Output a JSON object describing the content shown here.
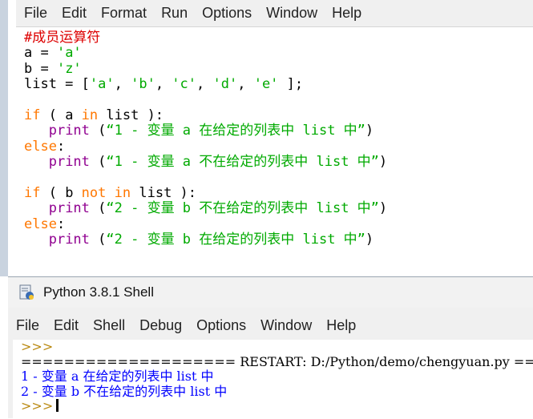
{
  "editor": {
    "menu": [
      "File",
      "Edit",
      "Format",
      "Run",
      "Options",
      "Window",
      "Help"
    ],
    "code": {
      "l1": "#成员运算符",
      "l2a": "a = ",
      "l2s": "'a'",
      "l3a": "b = ",
      "l3s": "'z'",
      "l4a": "list = [",
      "l4s1": "'a'",
      "l4c1": ", ",
      "l4s2": "'b'",
      "l4c2": ", ",
      "l4s3": "'c'",
      "l4c3": ", ",
      "l4s4": "'d'",
      "l4c4": ", ",
      "l4s5": "'e'",
      "l4e": " ];",
      "if1_kw": "if",
      "if1_a": " ( a ",
      "if1_in": "in",
      "if1_b": " list ):",
      "p1_pre": "   ",
      "p1_fn": "print",
      "p1_a": " (",
      "p1_s": "“1 - 变量 a 在给定的列表中 list 中”",
      "p1_e": ")",
      "else1": "else",
      "else1_c": ":",
      "p2_fn": "print",
      "p2_a": " (",
      "p2_s": "“1 - 变量 a 不在给定的列表中 list 中”",
      "p2_e": ")",
      "if2_kw": "if",
      "if2_a": " ( b ",
      "if2_not": "not",
      "if2_sp": " ",
      "if2_in": "in",
      "if2_b": " list ):",
      "p3_fn": "print",
      "p3_a": " (",
      "p3_s": "“2 - 变量 b 不在给定的列表中 list 中”",
      "p3_e": ")",
      "else2": "else",
      "else2_c": ":",
      "p4_fn": "print",
      "p4_a": " (",
      "p4_s": "“2 - 变量 b 在给定的列表中 list 中”",
      "p4_e": ")"
    }
  },
  "shell": {
    "title": "Python 3.8.1 Shell",
    "menu": [
      "File",
      "Edit",
      "Shell",
      "Debug",
      "Options",
      "Window",
      "Help"
    ],
    "lines": {
      "p1": ">>>",
      "restart": "==================== RESTART: D:/Python/demo/chengyuan.py ====================",
      "out1": "1 - 变量 a 在给定的列表中 list 中",
      "out2": "2 - 变量 b 不在给定的列表中 list 中",
      "p2": ">>>"
    }
  },
  "colors": {
    "comment": "#dd0000",
    "string": "#00aa00",
    "keyword": "#ff7700",
    "builtin": "#900090",
    "output": "#0000ff"
  }
}
